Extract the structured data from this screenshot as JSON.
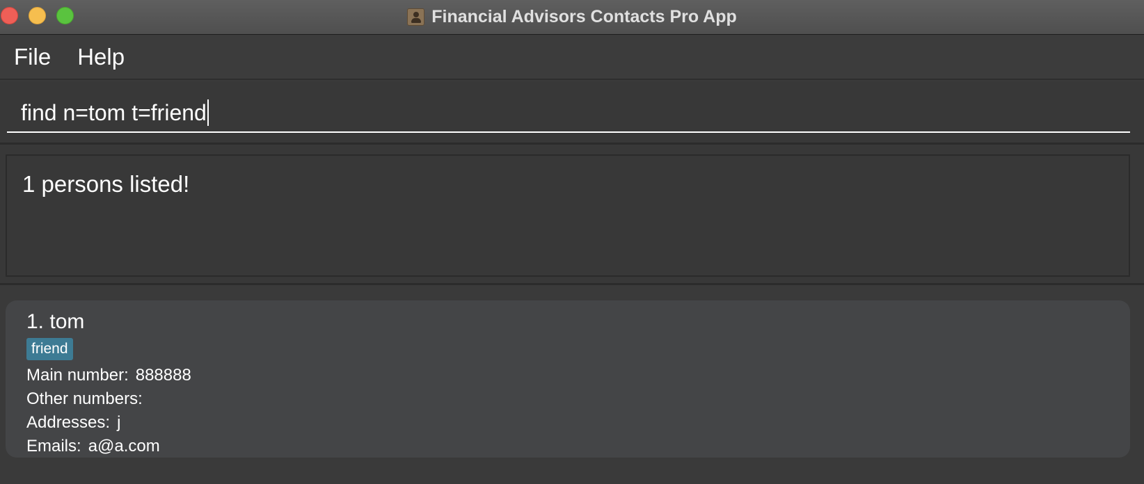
{
  "window": {
    "title": "Financial Advisors Contacts Pro App"
  },
  "menu": {
    "items": [
      "File",
      "Help"
    ]
  },
  "command": {
    "value": "find n=tom t=friend"
  },
  "result": {
    "message": "1 persons listed!"
  },
  "persons": [
    {
      "index_name": "1. tom",
      "tags": [
        "friend"
      ],
      "main_number_label": "Main number:",
      "main_number": "888888",
      "other_numbers_label": "Other numbers:",
      "other_numbers": "",
      "addresses_label": "Addresses:",
      "addresses": "j",
      "emails_label": "Emails:",
      "emails": "a@a.com"
    }
  ],
  "colors": {
    "close": "#ee5f57",
    "minimize": "#f6be4f",
    "maximize": "#5ac33f",
    "tag": "#3d7b94"
  },
  "icons": {
    "app": "contacts-book-icon"
  }
}
